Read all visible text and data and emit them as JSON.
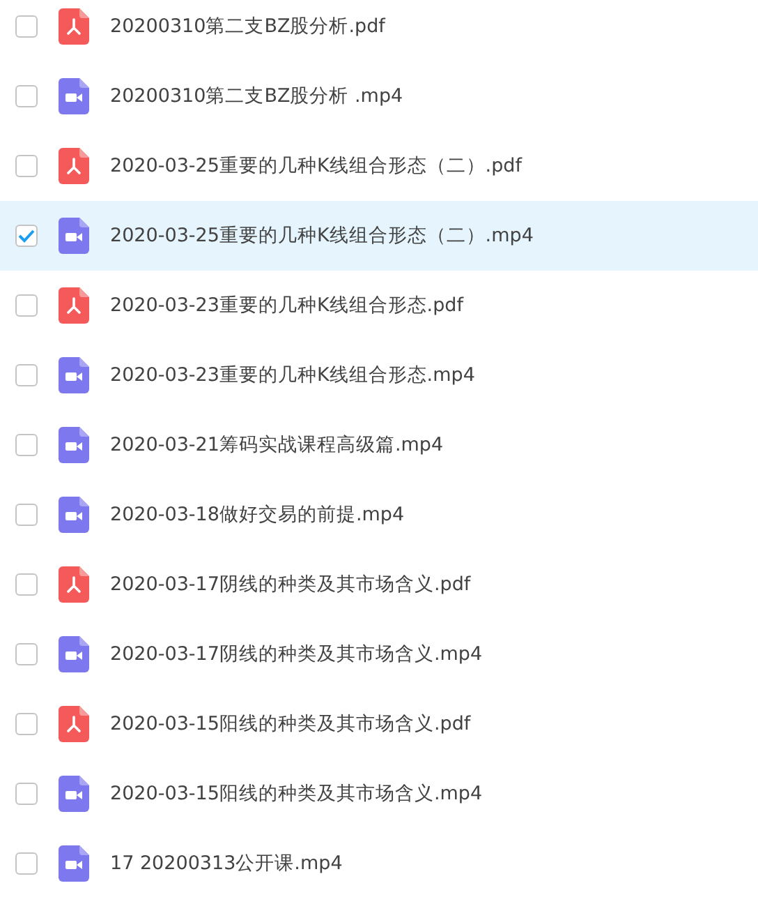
{
  "files": [
    {
      "kind": "pdf",
      "name": "20200310第二支BZ股分析.pdf",
      "selected": false
    },
    {
      "kind": "video",
      "name": "20200310第二支BZ股分析 .mp4",
      "selected": false
    },
    {
      "kind": "pdf",
      "name": "2020-03-25重要的几种K线组合形态（二）.pdf",
      "selected": false
    },
    {
      "kind": "video",
      "name": "2020-03-25重要的几种K线组合形态（二）.mp4",
      "selected": true
    },
    {
      "kind": "pdf",
      "name": "2020-03-23重要的几种K线组合形态.pdf",
      "selected": false
    },
    {
      "kind": "video",
      "name": "2020-03-23重要的几种K线组合形态.mp4",
      "selected": false
    },
    {
      "kind": "video",
      "name": "2020-03-21筹码实战课程高级篇.mp4",
      "selected": false
    },
    {
      "kind": "video",
      "name": "2020-03-18做好交易的前提.mp4",
      "selected": false
    },
    {
      "kind": "pdf",
      "name": "2020-03-17阴线的种类及其市场含义.pdf",
      "selected": false
    },
    {
      "kind": "video",
      "name": "2020-03-17阴线的种类及其市场含义.mp4",
      "selected": false
    },
    {
      "kind": "pdf",
      "name": "2020-03-15阳线的种类及其市场含义.pdf",
      "selected": false
    },
    {
      "kind": "video",
      "name": "2020-03-15阳线的种类及其市场含义.mp4",
      "selected": false
    },
    {
      "kind": "video",
      "name": "17 20200313公开课.mp4",
      "selected": false
    }
  ]
}
